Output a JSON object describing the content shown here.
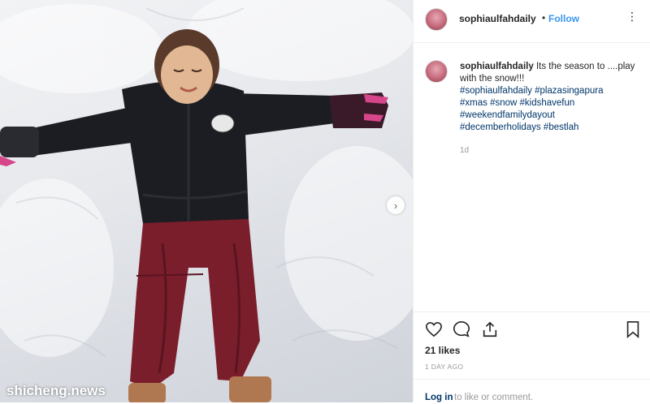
{
  "post": {
    "username": "sophiaulfahdaily",
    "separator": "•",
    "follow_label": "Follow",
    "more_label": "⋮",
    "caption": {
      "username": "sophiaulfahdaily",
      "text": "Its the season to ....play with the snow!!!",
      "hashtags_line1": "#sophiaulfahdaily #plazasingapura",
      "hashtags_line2": "#xmas #snow #kidshavefun",
      "hashtags_line3": "#weekendfamilydayout",
      "hashtags_line4": "#decemberholidays #bestlah",
      "time": "1d"
    },
    "likes": "21 likes",
    "date": "1 DAY AGO",
    "login_link": "Log in",
    "comment_prompt": "to like or comment."
  },
  "carousel": {
    "next_icon": "chevron-right-icon",
    "next_glyph": "›"
  },
  "watermark": "shicheng.news",
  "icons": {
    "like": "heart-icon",
    "comment": "comment-bubble-icon",
    "share": "share-icon",
    "save": "bookmark-icon"
  },
  "colors": {
    "link": "#3897f0",
    "hashtag": "#003569",
    "jacket": "#1c1d22",
    "pants": "#7a1e2c",
    "gloves": "#3a1a28"
  }
}
